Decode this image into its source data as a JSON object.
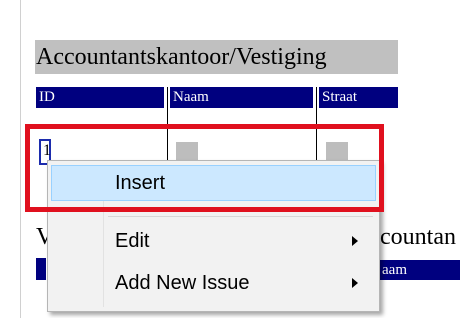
{
  "form": {
    "title": "Accountantskantoor/Vestiging",
    "columns": [
      "ID",
      "Naam",
      "Straat"
    ],
    "id_value": "1"
  },
  "lower": {
    "title_left": "V",
    "title_right": "countan",
    "header_right": "aam"
  },
  "context_menu": {
    "items": [
      {
        "label": "Insert",
        "has_submenu": false,
        "highlighted": true
      },
      {
        "label": "Edit",
        "has_submenu": true,
        "highlighted": false
      },
      {
        "label": "Add New Issue",
        "has_submenu": true,
        "highlighted": false
      }
    ]
  },
  "colors": {
    "header_bg": "#00007f",
    "title_bg": "#c0c0c0",
    "menu_highlight": "#cce8ff",
    "annotation_frame": "#e0101e"
  }
}
